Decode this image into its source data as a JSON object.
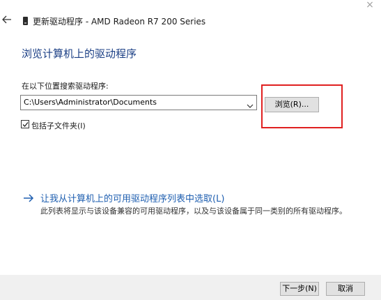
{
  "window": {
    "title": "更新驱动程序 - AMD Radeon R7 200 Series",
    "back_icon": "arrow-left-icon",
    "close_label": "×"
  },
  "page": {
    "title": "浏览计算机上的驱动程序"
  },
  "search": {
    "label": "在以下位置搜索驱动程序:",
    "path_value": "C:\\Users\\Administrator\\Documents",
    "browse_label": "浏览(R)...",
    "include_subfolders_label": "包括子文件夹(I)",
    "include_subfolders_checked": true
  },
  "pick_option": {
    "link_label": "让我从计算机上的可用驱动程序列表中选取(L)",
    "description": "此列表将显示与该设备兼容的可用驱动程序，以及与该设备属于同一类别的所有驱动程序。"
  },
  "footer": {
    "next_label": "下一步(N)",
    "cancel_label": "取消"
  },
  "colors": {
    "heading": "#1b3f85",
    "link": "#1f5fb0",
    "highlight": "#e02020",
    "footer_bg": "#f0f0f0"
  }
}
